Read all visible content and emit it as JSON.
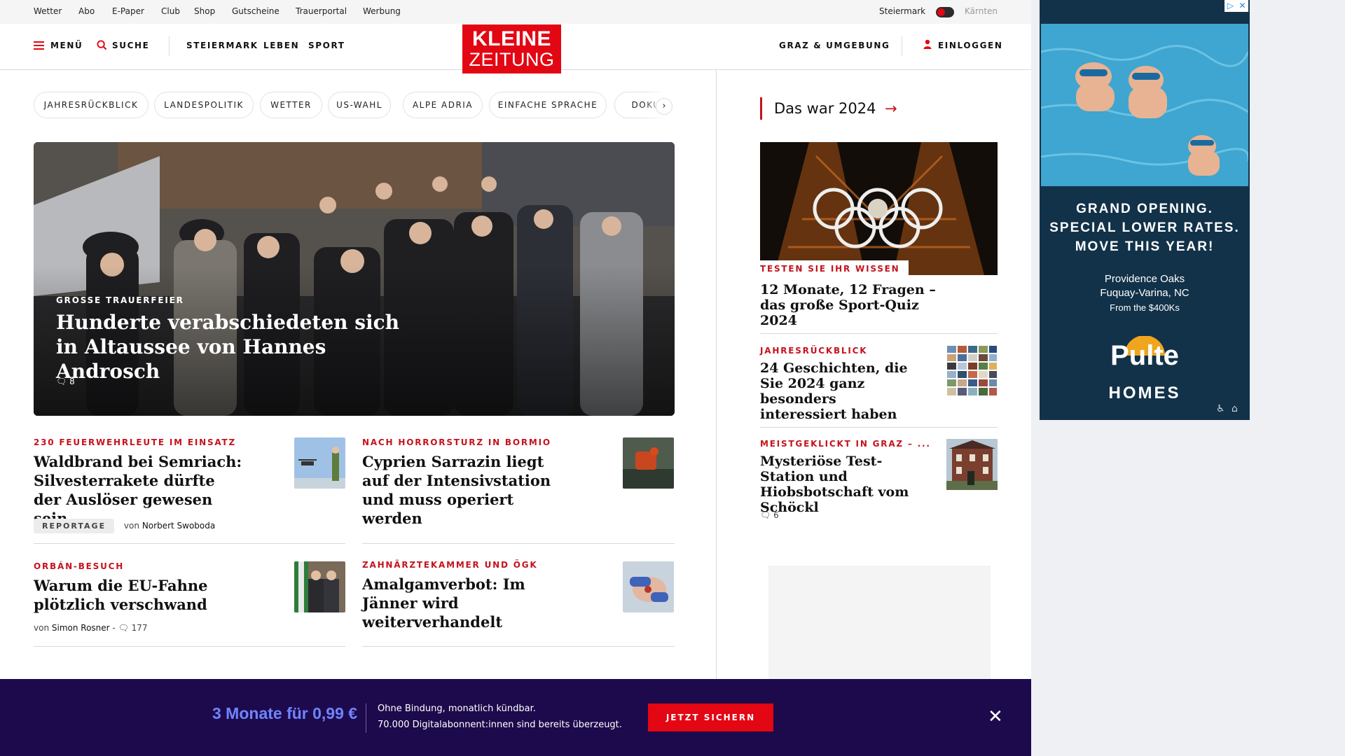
{
  "topbar": {
    "links": [
      "Wetter",
      "Abo",
      "E-Paper",
      "Club",
      "Shop",
      "Gutscheine",
      "Trauerportal",
      "Werbung"
    ],
    "region_active": "Steiermark",
    "region_inactive": "Kärnten"
  },
  "nav": {
    "menu": "MENÜ",
    "search": "SUCHE",
    "sections": [
      "STEIERMARK",
      "LEBEN",
      "SPORT"
    ],
    "logo_line1": "KLEINE",
    "logo_line2": "ZEITUNG",
    "region_link": "GRAZ & UMGEBUNG",
    "login": "EINLOGGEN"
  },
  "tags": [
    "JAHRESRÜCKBLICK",
    "LANDESPOLITIK",
    "WETTER",
    "US-WAHL",
    "ALPE ADRIA",
    "EINFACHE SPRACHE",
    "DOKU"
  ],
  "tags_next": "›",
  "hero": {
    "kicker": "GROSSE TRAUERFEIER",
    "title": "Hunderte verabschiedeten sich in Altaussee von Hannes Androsch",
    "comments": "8"
  },
  "articles": [
    {
      "kicker": "230 FEUERWEHRLEUTE IM EINSATZ",
      "title": "Waldbrand bei Semriach: Silvesterrakete dürfte der Auslöser gewesen sein",
      "badge": "REPORTAGE",
      "byline_prefix": "von",
      "author": "Norbert Swoboda"
    },
    {
      "kicker": "NACH HORRORSTURZ IN BORMIO",
      "title": "Cyprien Sarrazin liegt auf der Intensivstation und muss operiert werden"
    },
    {
      "kicker": "ORBÁN-BESUCH",
      "title": "Warum die EU-Fahne plötzlich verschwand",
      "byline_prefix": "von",
      "author": "Simon Rosner",
      "comments": "177"
    },
    {
      "kicker": "ZAHNÄRZTEKAMMER UND ÖGK",
      "title": "Amalgamverbot: Im Jänner wird weiterverhandelt"
    }
  ],
  "sidebar": {
    "heading": "Das war 2024",
    "arrow": "→",
    "feature_label": "TESTEN SIE IHR WISSEN",
    "feature_title": "12 Monate, 12 Fragen – das große Sport-Quiz 2024",
    "items": [
      {
        "kicker": "JAHRESRÜCKBLICK",
        "title": "24 Geschichten, die Sie 2024 ganz besonders interessiert haben"
      },
      {
        "kicker": "MEISTGEKLICKT IN GRAZ – ...",
        "title": "Mysteriöse Test-Station und Hiobsbotschaft vom Schöckl",
        "comments": "6"
      }
    ]
  },
  "ad": {
    "headline": [
      "GRAND OPENING.",
      "SPECIAL LOWER RATES.",
      "MOVE THIS YEAR!"
    ],
    "community": "Providence Oaks",
    "location": "Fuquay-Varina, NC",
    "price": "From the $400Ks",
    "brand_line1": "Pulte",
    "brand_line2": "HOMES",
    "choice_icons": [
      "▷",
      "✕"
    ],
    "corner_icons": [
      "♿",
      "⌂"
    ]
  },
  "promo": {
    "price": "3 Monate für 0,99 €",
    "line1": "Ohne Bindung, monatlich kündbar.",
    "line2": "70.000 Digitalabonnent:innen sind bereits überzeugt.",
    "button": "JETZT SICHERN",
    "close": "✕"
  },
  "colors": {
    "brand_red": "#e30613",
    "kicker_red": "#c5131d",
    "promo_bg": "#1d0a4c",
    "promo_price": "#6f84ff",
    "ad_bg": "#123249"
  }
}
